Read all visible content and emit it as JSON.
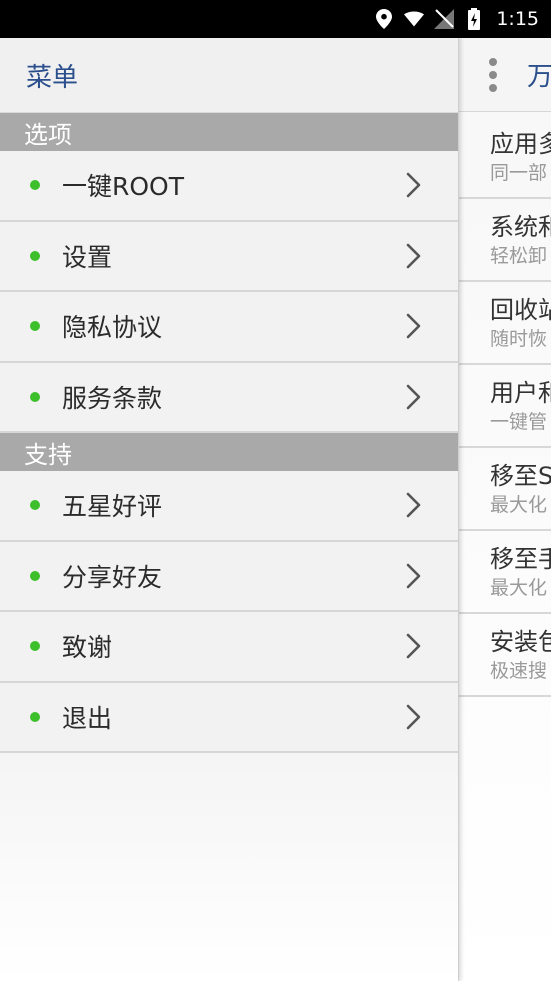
{
  "status_bar": {
    "time": "1:15",
    "icons": [
      "location-icon",
      "wifi-icon",
      "signal-icon",
      "battery-icon"
    ]
  },
  "drawer": {
    "title": "菜单",
    "sections": [
      {
        "header": "选项",
        "items": [
          {
            "label": "一键ROOT"
          },
          {
            "label": "设置"
          },
          {
            "label": "隐私协议"
          },
          {
            "label": "服务条款"
          }
        ]
      },
      {
        "header": "支持",
        "items": [
          {
            "label": "五星好评"
          },
          {
            "label": "分享好友"
          },
          {
            "label": "致谢"
          },
          {
            "label": "退出"
          }
        ]
      }
    ]
  },
  "main": {
    "title": "万",
    "items": [
      {
        "title": "应用多",
        "subtitle": "同一部"
      },
      {
        "title": "系统和",
        "subtitle": "轻松卸"
      },
      {
        "title": "回收站",
        "subtitle": "随时恢"
      },
      {
        "title": "用户和",
        "subtitle": "一键管"
      },
      {
        "title": "移至S",
        "subtitle": "最大化"
      },
      {
        "title": "移至手",
        "subtitle": "最大化"
      },
      {
        "title": "安装包",
        "subtitle": "极速搜"
      }
    ]
  },
  "colors": {
    "accent_title": "#2a4f8c",
    "bullet": "#3cbf2a",
    "section_bg": "#a9a9a9"
  }
}
